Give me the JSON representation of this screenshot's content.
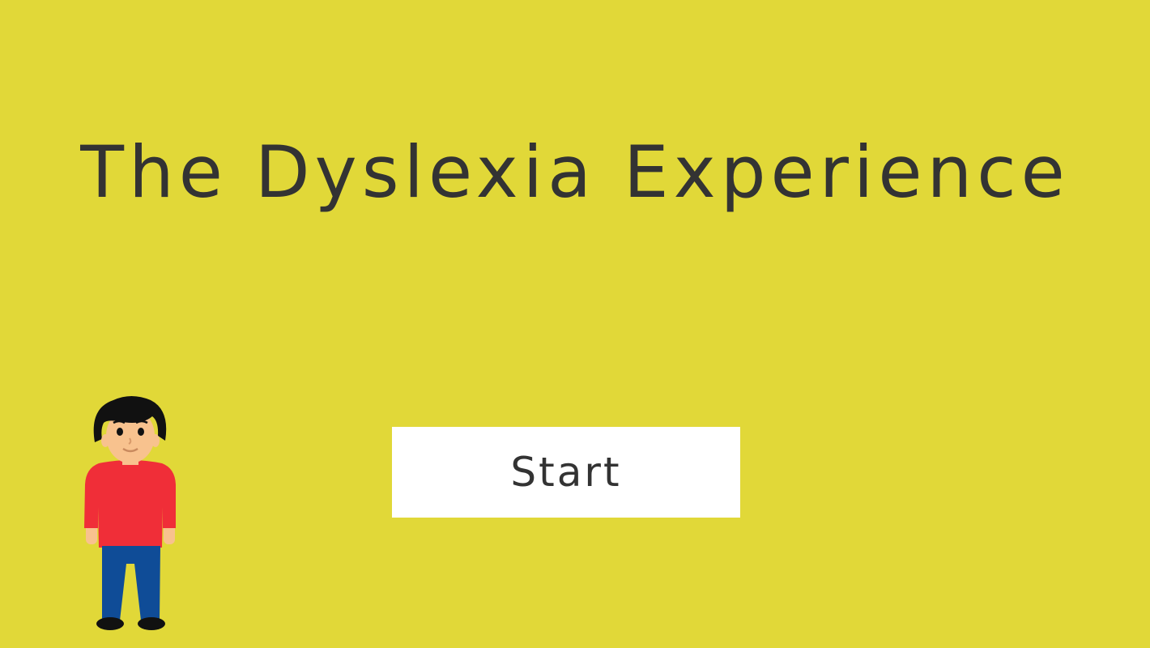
{
  "title": "The Dyslexia Experience",
  "start_button": {
    "label": "Start"
  },
  "character": {
    "icon": "boy-character-icon"
  },
  "colors": {
    "background": "#e1d838",
    "text": "#333333",
    "button": "#ffffff",
    "shirt": "#f02e38",
    "pants": "#0f4c97",
    "skin": "#f8c28e",
    "hair": "#111111"
  }
}
